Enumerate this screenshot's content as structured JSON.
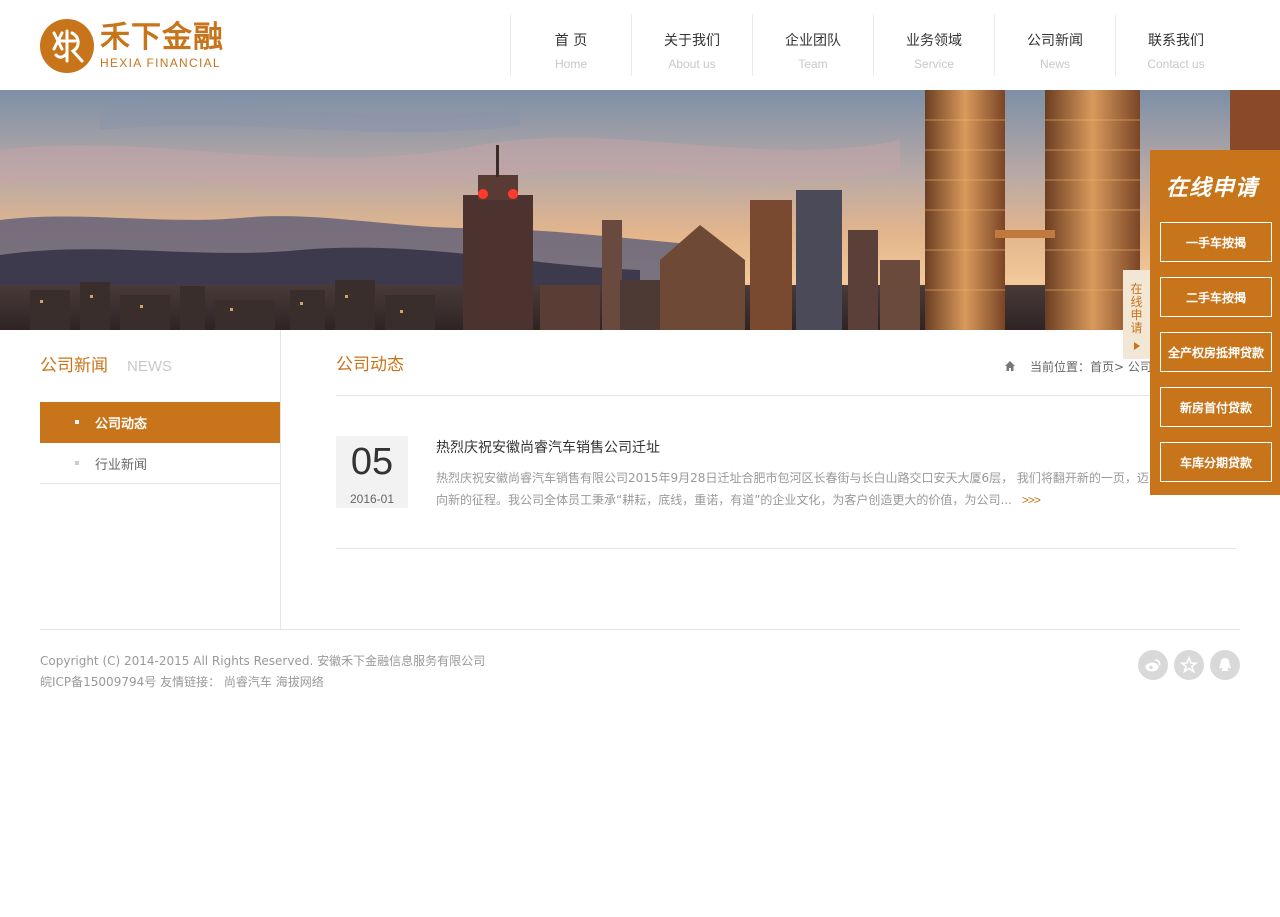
{
  "brand": {
    "name_cn": "禾下金融",
    "name_en": "HEXIA FINANCIAL",
    "color": "#c8741a"
  },
  "nav": [
    {
      "cn": "首 页",
      "en": "Home"
    },
    {
      "cn": "关于我们",
      "en": "About us"
    },
    {
      "cn": "企业团队",
      "en": "Team"
    },
    {
      "cn": "业务领域",
      "en": "Service"
    },
    {
      "cn": "公司新闻",
      "en": "News"
    },
    {
      "cn": "联系我们",
      "en": "Contact us"
    }
  ],
  "sidebar": {
    "title": "公司新闻",
    "title_en": "NEWS",
    "items": [
      {
        "label": "公司动态",
        "active": true
      },
      {
        "label": "行业新闻",
        "active": false
      }
    ]
  },
  "main": {
    "title": "公司动态",
    "breadcrumb": "当前位置：首页> 公司新闻> 公司动态"
  },
  "news": [
    {
      "day": "05",
      "year_month": "2016-01",
      "title": "热烈庆祝安徽尚睿汽车销售公司迁址",
      "summary": "热烈庆祝安徽尚睿汽车销售有限公司2015年9月28日迁址合肥市包河区长春街与长白山路交口安天大厦6层， 我们将翻开新的一页，迈向新的征程。我公司全体员工秉承“耕耘，底线，重诺，有道”的企业文化，为客户创造更大的价值，为公司...",
      "more": ">>>"
    }
  ],
  "float_panel": {
    "tab_label": "在线申请",
    "title": "在线申请",
    "buttons": [
      "一手车按揭",
      "二手车按揭",
      "全产权房抵押贷款",
      "新房首付贷款",
      "车库分期贷款"
    ]
  },
  "footer": {
    "copyright": "Copyright (C) 2014-2015 All Rights Reserved. 安徽禾下金融信息服务有限公司",
    "icp": "皖ICP备15009794号",
    "links_label": "友情链接：",
    "links": [
      "尚睿汽车",
      "海拔网络"
    ],
    "icons": [
      "weibo-icon",
      "star-icon",
      "qq-icon"
    ]
  }
}
